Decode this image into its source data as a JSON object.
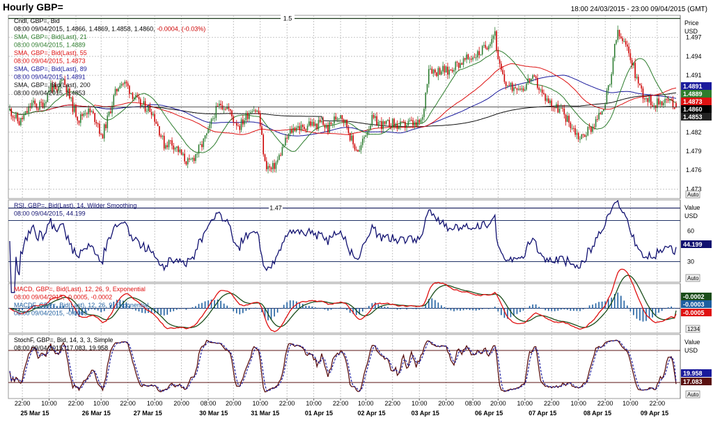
{
  "header": {
    "title": "Hourly GBP=",
    "range": "18:00 24/03/2015 - 23:00 09/04/2015 (GMT)"
  },
  "colors": {
    "up": "#2e7d32",
    "down": "#cc0000",
    "sma21": "#2d7d2d",
    "sma55": "#dd1111",
    "sma89": "#1a1a9c",
    "sma200": "#111111",
    "rsi": "#101070",
    "macd": "#e01010",
    "signal": "#1a4d1a",
    "hist": "#1f5fa0",
    "stoch_k": "#5a1010",
    "stoch_d": "#1a1a9c",
    "hline": "#223366"
  },
  "x_axis": {
    "hour_ticks": [
      "22:00",
      "10:00",
      "22:00",
      "10:00",
      "22:00",
      "10:00",
      "20:00",
      "08:00",
      "20:00",
      "10:00",
      "22:00",
      "10:00",
      "22:00",
      "10:00",
      "22:00",
      "10:00",
      "20:00",
      "08:00",
      "20:00",
      "10:00",
      "22:00",
      "10:00",
      "22:00",
      "10:00",
      "22:00"
    ],
    "date_ticks": [
      "25 Mar 15",
      "26 Mar 15",
      "27 Mar 15",
      "30 Mar 15",
      "31 Mar 15",
      "01 Apr 15",
      "02 Apr 15",
      "03 Apr 15",
      "06 Apr 15",
      "07 Apr 15",
      "08 Apr 15",
      "09 Apr 15"
    ]
  },
  "panels": {
    "price": {
      "legend": [
        {
          "text": "Cndl, GBP=, Bid",
          "color": "#000000"
        },
        {
          "text": "08:00 09/04/2015, 1.4866, 1.4869, 1.4858, 1.4860,",
          "color": "#000000",
          "extra": "-0.0004, (-0.03%)",
          "extra_color": "#cc0000"
        },
        {
          "text": "SMA, GBP=, Bid(Last), 21",
          "color": "#2d7d2d"
        },
        {
          "text": "08:00 09/04/2015, 1.4889",
          "color": "#2d7d2d"
        },
        {
          "text": "SMA, GBP=, Bid(Last), 55",
          "color": "#dd1111"
        },
        {
          "text": "08:00 09/04/2015, 1.4873",
          "color": "#dd1111"
        },
        {
          "text": "SMA, GBP=, Bid(Last), 89",
          "color": "#1a1a9c"
        },
        {
          "text": "08:00 09/04/2015, 1.4891",
          "color": "#1a1a9c"
        },
        {
          "text": "SMA, GBP=, Bid(Last), 200",
          "color": "#111111"
        },
        {
          "text": "08:00 09/04/2015, 1.4853",
          "color": "#111111"
        }
      ],
      "axis_title": [
        "Price",
        "USD"
      ],
      "ticks": [
        "1.497",
        "1.494",
        "1.491",
        "1.488",
        "1.485",
        "1.482",
        "1.479",
        "1.476",
        "1.473"
      ],
      "hline_labels": [
        "1.5",
        "1.47"
      ],
      "badges": [
        {
          "text": "1.4891",
          "bg": "#1a1a9c"
        },
        {
          "text": "1.4889",
          "bg": "#2d7d2d"
        },
        {
          "text": "1.4873",
          "bg": "#dd1111"
        },
        {
          "text": "1.4860",
          "bg": "#000000"
        },
        {
          "text": "1.4853",
          "bg": "#222222"
        }
      ],
      "button": "Auto"
    },
    "rsi": {
      "legend": [
        {
          "text": "RSI, GBP=, Bid(Last), 14, Wilder Smoothing",
          "color": "#101070"
        },
        {
          "text": "08:00 09/04/2015, 44.199",
          "color": "#101070"
        }
      ],
      "axis_title": [
        "Value",
        "USD"
      ],
      "ticks": [
        "60",
        "30"
      ],
      "badges": [
        {
          "text": "44.199",
          "bg": "#101070"
        }
      ],
      "button": "Auto"
    },
    "macd": {
      "legend": [
        {
          "text": "MACD, GBP=, Bid(Last), 12, 26, 9, Exponential",
          "color": "#e01010"
        },
        {
          "text": "08:00 09/04/2015, -0.0005, -0.0002",
          "color": "#e01010"
        },
        {
          "text": "MACDF, GBP=, Bid(Last), 12, 26, 9, Exponential",
          "color": "#1f5fa0"
        },
        {
          "text": "08:00 09/04/2015, -0.0003",
          "color": "#1f5fa0"
        }
      ],
      "badges": [
        {
          "text": "-0.0002",
          "bg": "#1a4d1a"
        },
        {
          "text": "-0.0003",
          "bg": "#1f5fa0"
        },
        {
          "text": "-0.0005",
          "bg": "#e01010"
        }
      ],
      "button": "1234"
    },
    "stoch": {
      "legend": [
        {
          "text": "StochF, GBP=, Bid, 14, 3, 3, Simple",
          "color": "#000000"
        },
        {
          "text": "08:00 09/04/2015, 17.083, 19.958",
          "color": "#000000"
        }
      ],
      "axis_title": [
        "Value",
        "USD"
      ],
      "ticks": [
        "40"
      ],
      "badges": [
        {
          "text": "19.958",
          "bg": "#1a1a9c"
        },
        {
          "text": "17.083",
          "bg": "#5a1010"
        }
      ],
      "button": "Auto"
    }
  },
  "chart_data": {
    "type": "candlestick",
    "title": "Hourly GBP=",
    "instrument": "GBP=",
    "interval": "hourly",
    "ylim": [
      1.4715,
      1.5005
    ],
    "hlines": [
      1.5,
      1.47
    ],
    "last": {
      "open": 1.4866,
      "high": 1.4869,
      "low": 1.4858,
      "close": 1.486
    },
    "price_path_anchors": [
      [
        0,
        1.4855
      ],
      [
        3,
        1.4845
      ],
      [
        6,
        1.4835
      ],
      [
        10,
        1.4848
      ],
      [
        14,
        1.4865
      ],
      [
        18,
        1.486
      ],
      [
        22,
        1.4868
      ],
      [
        26,
        1.4895
      ],
      [
        30,
        1.488
      ],
      [
        33,
        1.491
      ],
      [
        36,
        1.489
      ],
      [
        40,
        1.486
      ],
      [
        44,
        1.484
      ],
      [
        48,
        1.4855
      ],
      [
        52,
        1.485
      ],
      [
        56,
        1.4835
      ],
      [
        58,
        1.481
      ],
      [
        62,
        1.484
      ],
      [
        66,
        1.4875
      ],
      [
        70,
        1.49
      ],
      [
        74,
        1.4895
      ],
      [
        78,
        1.488
      ],
      [
        82,
        1.4865
      ],
      [
        86,
        1.486
      ],
      [
        90,
        1.4855
      ],
      [
        94,
        1.483
      ],
      [
        98,
        1.48
      ],
      [
        102,
        1.4805
      ],
      [
        106,
        1.4795
      ],
      [
        110,
        1.478
      ],
      [
        114,
        1.477
      ],
      [
        118,
        1.4785
      ],
      [
        122,
        1.48
      ],
      [
        126,
        1.482
      ],
      [
        130,
        1.485
      ],
      [
        134,
        1.4865
      ],
      [
        138,
        1.486
      ],
      [
        142,
        1.484
      ],
      [
        146,
        1.483
      ],
      [
        150,
        1.4845
      ],
      [
        154,
        1.486
      ],
      [
        158,
        1.485
      ],
      [
        162,
        1.477
      ],
      [
        166,
        1.476
      ],
      [
        170,
        1.4775
      ],
      [
        174,
        1.48
      ],
      [
        178,
        1.482
      ],
      [
        182,
        1.483
      ],
      [
        186,
        1.4825
      ],
      [
        190,
        1.4835
      ],
      [
        194,
        1.483
      ],
      [
        198,
        1.4835
      ],
      [
        202,
        1.4825
      ],
      [
        206,
        1.484
      ],
      [
        210,
        1.485
      ],
      [
        214,
        1.483
      ],
      [
        218,
        1.48
      ],
      [
        222,
        1.479
      ],
      [
        226,
        1.482
      ],
      [
        230,
        1.484
      ],
      [
        234,
        1.4835
      ],
      [
        238,
        1.483
      ],
      [
        242,
        1.4835
      ],
      [
        246,
        1.483
      ],
      [
        250,
        1.483
      ],
      [
        254,
        1.4835
      ],
      [
        258,
        1.483
      ],
      [
        262,
        1.484
      ],
      [
        266,
        1.4925
      ],
      [
        270,
        1.4915
      ],
      [
        274,
        1.492
      ],
      [
        278,
        1.4915
      ],
      [
        282,
        1.4925
      ],
      [
        286,
        1.493
      ],
      [
        290,
        1.4935
      ],
      [
        294,
        1.494
      ],
      [
        298,
        1.4945
      ],
      [
        302,
        1.4955
      ],
      [
        306,
        1.497
      ],
      [
        308,
        1.498
      ],
      [
        310,
        1.493
      ],
      [
        314,
        1.49
      ],
      [
        318,
        1.489
      ],
      [
        322,
        1.4895
      ],
      [
        326,
        1.489
      ],
      [
        330,
        1.4905
      ],
      [
        334,
        1.49
      ],
      [
        338,
        1.488
      ],
      [
        342,
        1.487
      ],
      [
        346,
        1.486
      ],
      [
        350,
        1.4855
      ],
      [
        354,
        1.484
      ],
      [
        358,
        1.4825
      ],
      [
        362,
        1.481
      ],
      [
        366,
        1.482
      ],
      [
        370,
        1.483
      ],
      [
        374,
        1.4845
      ],
      [
        378,
        1.487
      ],
      [
        382,
        1.4905
      ],
      [
        384,
        1.496
      ],
      [
        386,
        1.4975
      ],
      [
        390,
        1.496
      ],
      [
        394,
        1.494
      ],
      [
        398,
        1.4905
      ],
      [
        402,
        1.488
      ],
      [
        406,
        1.487
      ],
      [
        410,
        1.4865
      ],
      [
        414,
        1.487
      ],
      [
        418,
        1.487
      ],
      [
        423,
        1.486
      ]
    ],
    "rsi_level_lines": [
      70,
      30
    ],
    "rsi_last": 44.199,
    "macd_last": {
      "macd": -0.0005,
      "signal": -0.0002,
      "hist": -0.0003
    },
    "stoch_level_lines": [
      80,
      20
    ],
    "stoch_last": {
      "k": 17.083,
      "d": 19.958
    }
  }
}
